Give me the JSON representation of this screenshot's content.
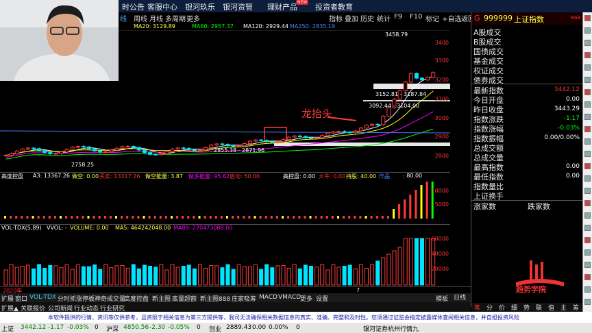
{
  "topbar": {
    "items": [
      "时公告",
      "客服中心",
      "银河玖乐",
      "银河资管",
      "理财产品",
      "投资者教育"
    ],
    "new_badge": "NEW"
  },
  "toolbar": {
    "tabs": [
      "线",
      "周线",
      "月线",
      "多周期",
      "更多"
    ],
    "right": [
      "指标",
      "叠加",
      "历史",
      "统计",
      "F9",
      "F10",
      "标记",
      "+自选",
      "返回"
    ]
  },
  "ma": {
    "ma20": "MA20: 3129.89",
    "ma60": "MA60: 2957.37",
    "ma120": "MA120: 2929.44",
    "ma250": "MA250: 2835.19"
  },
  "chart_labels": {
    "high": "3458.79",
    "range1": "3152.81 - 3187.84",
    "range2": "3092.44 - 3104.00",
    "low": "2758.25",
    "range3": "2855.38 - 2871.96",
    "dragon": "龙抬头"
  },
  "price_axis": [
    "3400",
    "3300",
    "3200",
    "3100",
    "3000",
    "2900",
    "2800"
  ],
  "ind1": {
    "name": "高度控盘",
    "a3": "A3: 13367.26",
    "gk": "做空: 0.00",
    "mc": "买卖: 13317.26",
    "jg": "做空能量: 3.87",
    "tz": "做多能量: 95.62",
    "zf": "启动: 50.00",
    "gdkp": "高控盘: 0.00",
    "dn": "大牛: 0.00",
    "cg": "持股: 40.00",
    "sj": "作品",
    "end": ": 80.00",
    "axis": [
      "10000",
      "5000"
    ]
  },
  "ind2": {
    "name": "VOL-TDX(5,89)",
    "vvol": "VVOL: -",
    "volume": "VOLUME: 0.00",
    "ma5": "MA5: 464242048.00",
    "ma89": "MA89: 270473088.00",
    "axis": [
      "60000",
      "40000",
      "20000"
    ]
  },
  "x_axis": {
    "left": "2020年",
    "mid": "7"
  },
  "bottom_tabs": [
    "扩展",
    "窗口",
    "VOL-TDX",
    "分时抓涨停板",
    "神奇成交量",
    "高度控盘",
    "新主图",
    "底量超额",
    "新主图888",
    "庄家吸筹",
    "MACD",
    "VMACD",
    "更多",
    "设置"
  ],
  "bottom_right": [
    "模板",
    "日线"
  ],
  "rp": {
    "code": "G",
    "number": "999999",
    "name": "上证指数",
    "tag": "SG3",
    "menu": [
      "A股成交",
      "B股成交",
      "国债成交",
      "基金成交",
      "权证成交",
      "债券成交"
    ],
    "rows": [
      [
        "最新指数",
        "3442.12"
      ],
      [
        "今日开盘",
        "0.00"
      ],
      [
        "昨日收盘",
        "3443.29"
      ],
      [
        "指数涨跌",
        "-1.17"
      ],
      [
        "指数涨幅",
        "-0.03%"
      ],
      [
        "指数振幅",
        "0.00/0.00%"
      ],
      [
        "总成交额",
        ""
      ],
      [
        "总成交量",
        ""
      ],
      [
        "最高指数",
        "0.00"
      ],
      [
        "最低指数",
        "0.00"
      ],
      [
        "指数量比",
        ""
      ],
      [
        "上证换手",
        ""
      ]
    ],
    "up_down": [
      "涨家数",
      "跌家数"
    ],
    "footer": [
      "笔",
      "分",
      "价",
      "细",
      "势",
      "联",
      "值",
      "主",
      "筹"
    ]
  },
  "disclaimer": "本软件提供的行情、资讯等仅供参考，且资限于相关信息为第三方提供等，我司无法确保相关数据信息的真实、准确、完整和及时性。您须通过证监会指定披露媒体查阅相关信息，并自担投资风险",
  "menubar": [
    "扩展▲",
    "关联报价",
    "公司新闻",
    "行业动态",
    "行业研究"
  ],
  "status": [
    "上证",
    "3442.12",
    "-1.17",
    "-0.03%",
    "0",
    "沪深",
    "4850.56",
    "-2.30",
    "-0.05%",
    "0",
    "创业",
    "2889.43",
    "0.00",
    "0.00%",
    "0",
    "银河证券杭州行情九"
  ],
  "watermark": "趋势学院",
  "colors": {
    "up": "#ff3b3b",
    "down": "#00e5ff",
    "ma_yellow": "#ffff00",
    "ma_white": "#ffffff",
    "ma_green": "#00ff00",
    "ma_purple": "#ff00ff",
    "ma_blue": "#4b7bff"
  }
}
